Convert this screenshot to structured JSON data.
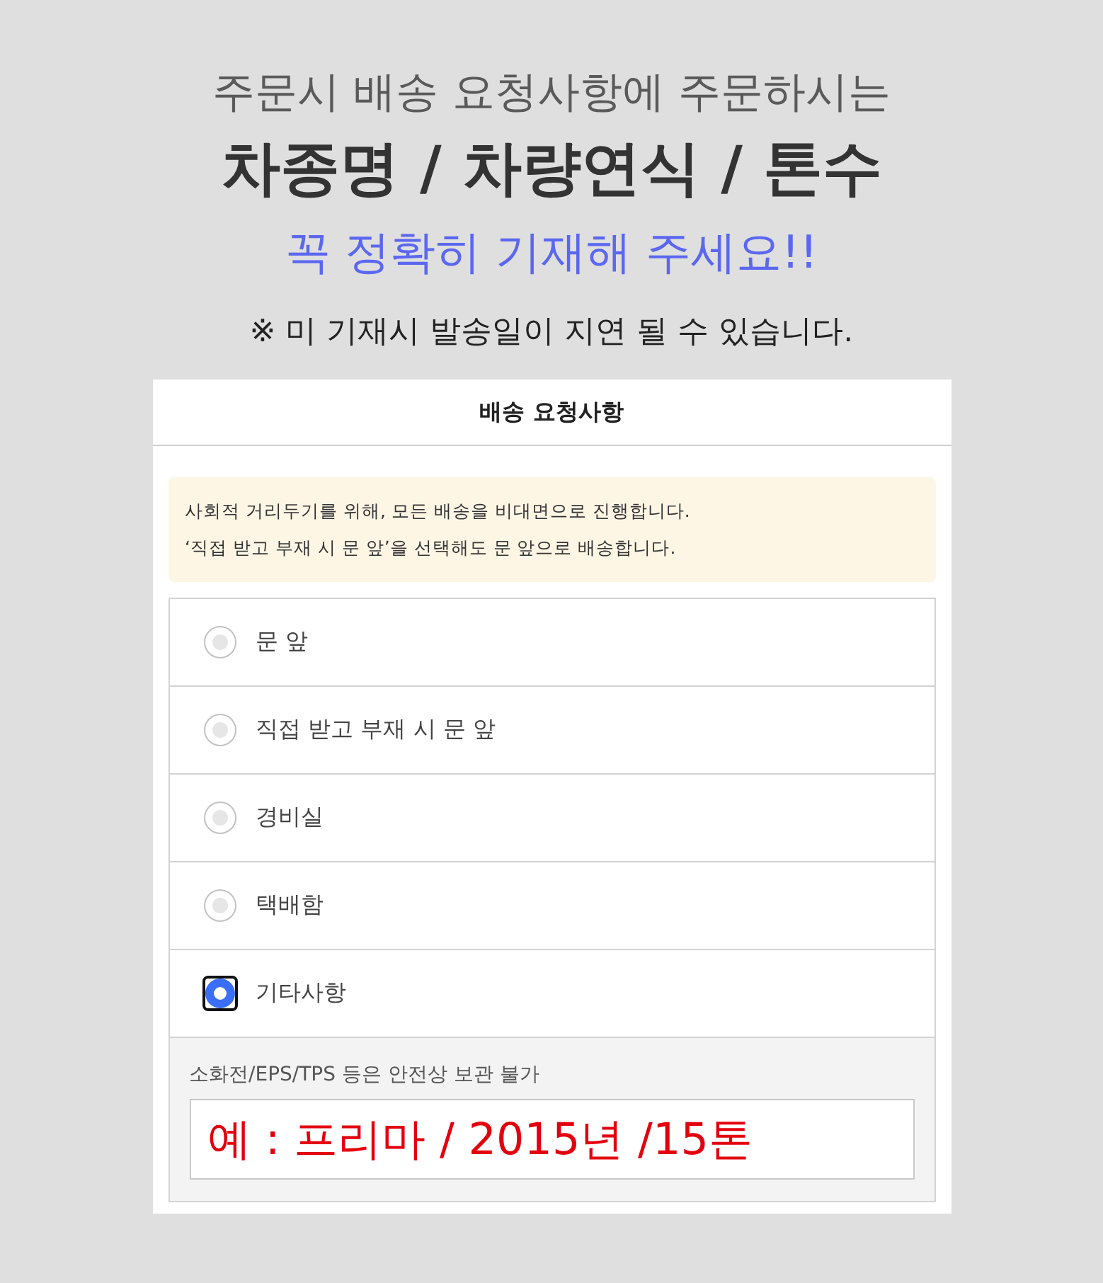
{
  "heading": {
    "line_1": "주문시 배송 요청사항에 주문하시는",
    "line_2": "차종명 / 차량연식 / 톤수",
    "line_3": "꼭 정확히 기재해 주세요!!",
    "note": "※ 미 기재시 발송일이 지연 될 수 있습니다."
  },
  "panel": {
    "title": "배송 요청사항",
    "notice": [
      "사회적 거리두기를 위해, 모든 배송을 비대면으로 진행합니다.",
      "‘직접 받고 부재 시 문 앞’을 선택해도 문 앞으로 배송합니다."
    ],
    "options": [
      {
        "label": "문 앞",
        "selected": false
      },
      {
        "label": "직접 받고 부재 시 문 앞",
        "selected": false
      },
      {
        "label": "경비실",
        "selected": false
      },
      {
        "label": "택배함",
        "selected": false
      },
      {
        "label": "기타사항",
        "selected": true
      }
    ],
    "other": {
      "hint": "소화전/EPS/TPS 등은 안전상 보관 불가",
      "value": "예 : 프리마 / 2015년 /15톤"
    }
  }
}
